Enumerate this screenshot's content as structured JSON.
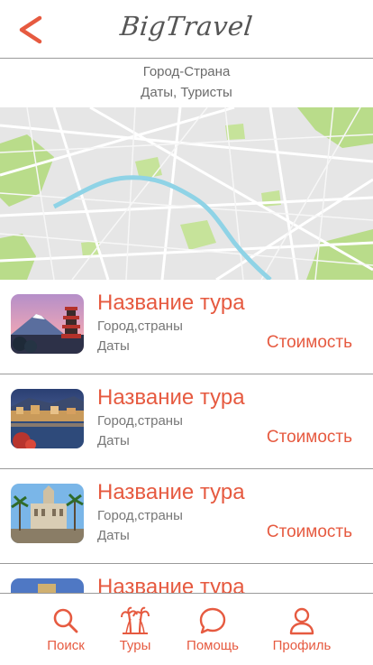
{
  "app": {
    "logo": "BigTravel",
    "accent_color": "#e65a40"
  },
  "header": {
    "back_icon": "back-chevron-icon"
  },
  "search_summary": {
    "destination": "Город-Страна",
    "dates_tourists": "Даты, Туристы"
  },
  "tours": [
    {
      "name": "Название тура",
      "location": "Город,страны",
      "dates": "Даты",
      "price": "Стоимость",
      "image": "japan-pagoda-fuji"
    },
    {
      "name": "Название тура",
      "location": "Город,страны",
      "dates": "Даты",
      "price": "Стоимость",
      "image": "lakeside-town-evening"
    },
    {
      "name": "Название тура",
      "location": "Город,страны",
      "dates": "Даты",
      "price": "Стоимость",
      "image": "palace-with-palms"
    },
    {
      "name": "Название тура",
      "location": "",
      "dates": "",
      "price": "",
      "image": "city-partial"
    }
  ],
  "tabbar": {
    "tabs": [
      {
        "label": "Поиск",
        "icon": "search-icon"
      },
      {
        "label": "Туры",
        "icon": "palm-trees-icon"
      },
      {
        "label": "Помощь",
        "icon": "chat-bubble-icon"
      },
      {
        "label": "Профиль",
        "icon": "user-icon"
      }
    ]
  }
}
